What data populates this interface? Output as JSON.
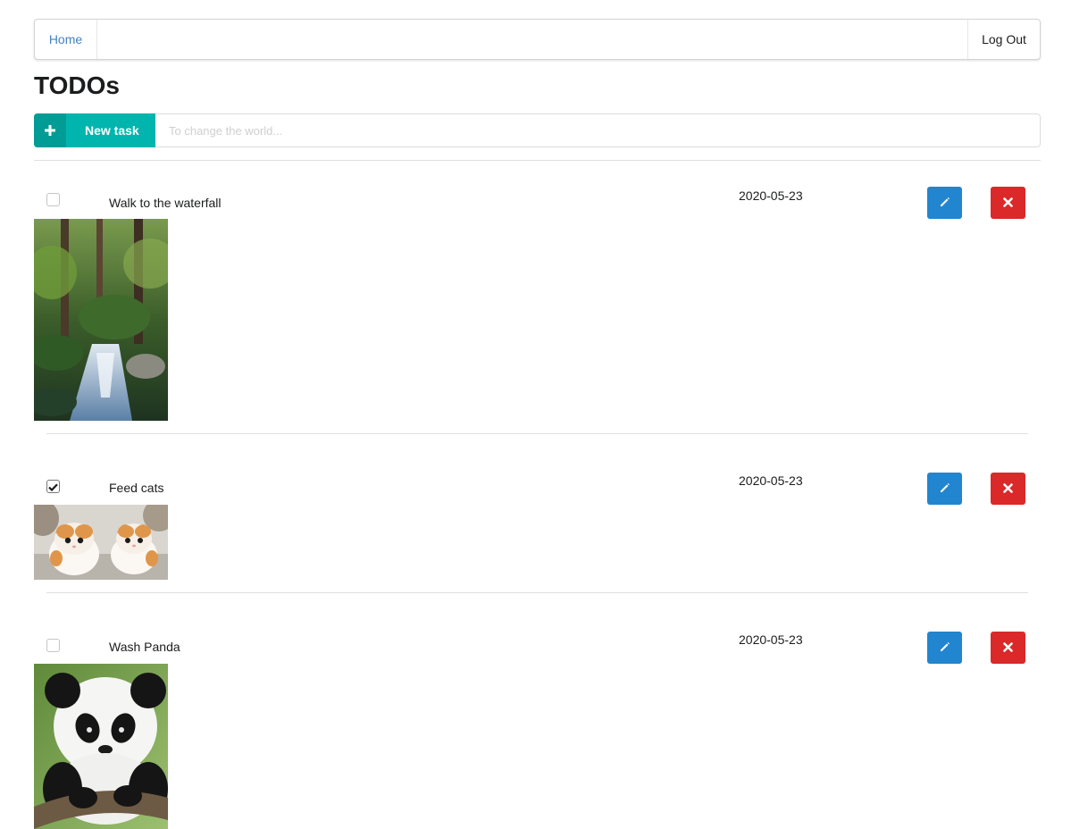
{
  "menu": {
    "home_label": "Home",
    "logout_label": "Log Out"
  },
  "page": {
    "title": "TODOs"
  },
  "new_task": {
    "button_label": "New task",
    "input_placeholder": "To change the world...",
    "input_value": ""
  },
  "colors": {
    "teal": "#00b5ad",
    "blue": "#2185d0",
    "red": "#db2828",
    "link": "#4183c4"
  },
  "todos": [
    {
      "title": "Walk to the waterfall",
      "date": "2020-05-23",
      "done": false,
      "image": "waterfall"
    },
    {
      "title": "Feed cats",
      "date": "2020-05-23",
      "done": true,
      "image": "kittens"
    },
    {
      "title": "Wash Panda",
      "date": "2020-05-23",
      "done": false,
      "image": "panda"
    }
  ],
  "icons": {
    "add": "plus-icon",
    "edit": "pencil-icon",
    "delete": "close-icon",
    "check": "check-icon"
  }
}
